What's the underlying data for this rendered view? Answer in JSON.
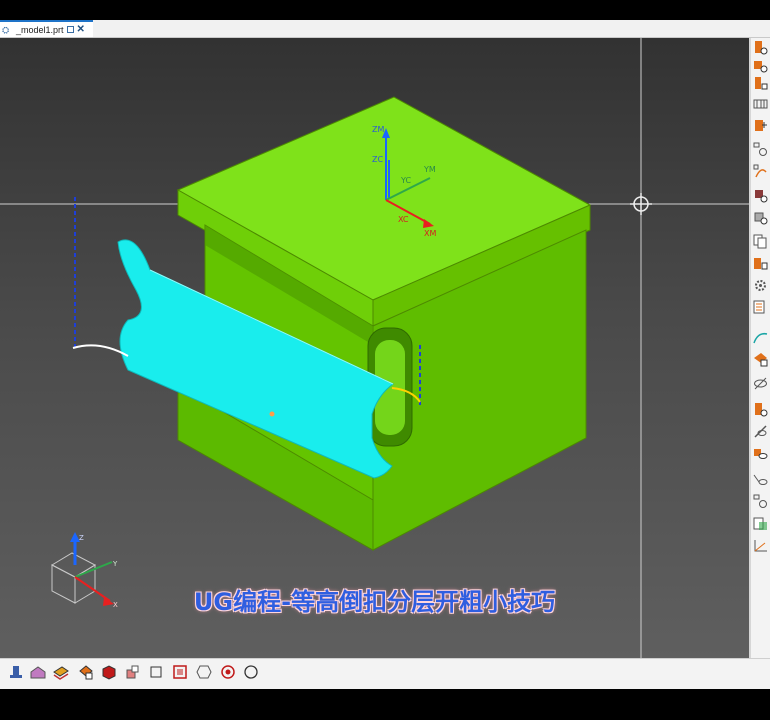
{
  "window": {
    "tab_title": "_model1.prt"
  },
  "viewport": {
    "caption": "UG编程-等高倒扣分层开粗小技巧",
    "wcs_labels": {
      "zm": "ZM",
      "zc": "ZC",
      "ym": "YM",
      "yc": "YC",
      "xc": "XC",
      "xm": "XM"
    },
    "triad_labels": {
      "z": "Z",
      "y": "Y",
      "x": "X"
    },
    "colors": {
      "part": "#6ad000",
      "surface": "#1cf0f0",
      "accent_yellow": "#ffd200"
    }
  },
  "right_toolbar": {
    "icons": [
      "feature-icon",
      "feature-add-icon",
      "feature-op-icon",
      "mesh-icon",
      "blend-icon",
      "sync-icon",
      "curve-icon",
      "cube-op-icon",
      "cube-op2-icon",
      "copy-icon",
      "cube-edit-icon",
      "settings-icon",
      "list-icon",
      "spline-icon",
      "surface-icon",
      "hide-icon",
      "feature-box-icon",
      "hide-all-icon",
      "view-icon",
      "curve-view-icon",
      "sync2-icon",
      "paste-icon",
      "axis-icon"
    ]
  },
  "bottom_toolbar": {
    "icons": [
      "push-pull-icon",
      "part-nav-icon",
      "layers-icon",
      "assembly-icon",
      "cube-icon",
      "shapes-icon",
      "square-icon",
      "red-box-icon",
      "hexagon-icon",
      "record-icon",
      "circle-icon"
    ]
  }
}
